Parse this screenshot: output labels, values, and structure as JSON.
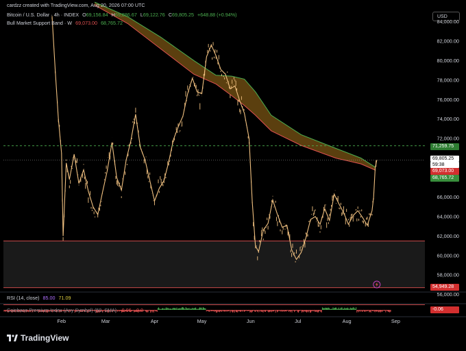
{
  "header": {
    "credit": "cardzz created with TradingView.com, Aug 20, 2026 07:00 UTC",
    "symbol": "Bitcoin / U.S. Dollar · 4h · INDEX",
    "open_label": "O",
    "open": "69,156.84",
    "high_label": "H",
    "high": "69,886.67",
    "low_label": "L",
    "low": "69,122.76",
    "close_label": "C",
    "close": "69,805.25",
    "change": "+648.88 (+0.94%)",
    "indicator": "Bull Market Support Band · W",
    "indicator_val1": "69,073.00",
    "indicator_val2": "68,765.72"
  },
  "currency_button": "USD",
  "price_tags": {
    "resistance": "71,259.75",
    "last": "69,805.25",
    "countdown": "59:38",
    "band_upper": "69,073.00",
    "band_lower": "68,765.72",
    "support": "54,949.28"
  },
  "rsi": {
    "label": "RSI (14, close)",
    "v1": "85.00",
    "v2": "71.09"
  },
  "premium": {
    "label": "Coinbase Premium Index (Any Symbol) (50, SMA)",
    "v1": "-0.06",
    "v2": "-0.0",
    "tag": "-0.06"
  },
  "brand": "TradingView",
  "colors": {
    "background": "#000000",
    "candle": "#f0c080",
    "band_fill": "#6b4a12",
    "band_upper": "#4caf50",
    "band_lower": "#e05050",
    "resistance_line": "#4caf50",
    "support_zone": "#e05050"
  },
  "chart_data": {
    "type": "line",
    "title": "",
    "xlabel": "",
    "ylabel": "",
    "x_ticks": [
      "Feb",
      "Mar",
      "Apr",
      "May",
      "Jun",
      "Jul",
      "Aug",
      "Sep"
    ],
    "y_ticks": [
      "84,000.00",
      "82,000.00",
      "80,000.00",
      "78,000.00",
      "76,000.00",
      "74,000.00",
      "72,000.00",
      "66,000.00",
      "64,000.00",
      "62,000.00",
      "60,000.00",
      "58,000.00",
      "56,000.00"
    ],
    "ylim": [
      55200,
      85600
    ],
    "grid": false,
    "series": [
      {
        "points": [
          [
            "Jan 26",
            84500
          ],
          [
            "Jan 28",
            79000
          ],
          [
            "Jan 30",
            74000
          ],
          [
            "Feb 1",
            70500
          ],
          [
            "Feb 2",
            62000
          ],
          [
            "Feb 4",
            69500
          ],
          [
            "Feb 6",
            67800
          ],
          [
            "Feb 9",
            70400
          ],
          [
            "Feb 12",
            67400
          ],
          [
            "Feb 15",
            68800
          ],
          [
            "Feb 18",
            66600
          ],
          [
            "Feb 21",
            65000
          ],
          [
            "Feb 24",
            64200
          ],
          [
            "Feb 27",
            66500
          ],
          [
            "Mar 2",
            68700
          ],
          [
            "Mar 5",
            71600
          ],
          [
            "Mar 8",
            68000
          ],
          [
            "Mar 11",
            66700
          ],
          [
            "Mar 14",
            69800
          ],
          [
            "Mar 17",
            71800
          ],
          [
            "Mar 20",
            74500
          ],
          [
            "Mar 23",
            71100
          ],
          [
            "Mar 26",
            69800
          ],
          [
            "Mar 29",
            67700
          ],
          [
            "Apr 1",
            65600
          ],
          [
            "Apr 4",
            66900
          ],
          [
            "Apr 7",
            67700
          ],
          [
            "Apr 10",
            69600
          ],
          [
            "Apr 13",
            71900
          ],
          [
            "Apr 16",
            73200
          ],
          [
            "Apr 19",
            74300
          ],
          [
            "Apr 22",
            76600
          ],
          [
            "Apr 25",
            78200
          ],
          [
            "Apr 28",
            76800
          ],
          [
            "May 1",
            76600
          ],
          [
            "May 4",
            80400
          ],
          [
            "May 7",
            81600
          ],
          [
            "May 10",
            80500
          ],
          [
            "May 13",
            79100
          ],
          [
            "May 16",
            78600
          ],
          [
            "May 19",
            77100
          ],
          [
            "May 22",
            77400
          ],
          [
            "May 25",
            75900
          ],
          [
            "May 28",
            74600
          ],
          [
            "May 31",
            72000
          ],
          [
            "Jun 2",
            65500
          ],
          [
            "Jun 4",
            61000
          ],
          [
            "Jun 6",
            60400
          ],
          [
            "Jun 9",
            62600
          ],
          [
            "Jun 12",
            63300
          ],
          [
            "Jun 15",
            65700
          ],
          [
            "Jun 18",
            64200
          ],
          [
            "Jun 21",
            62900
          ],
          [
            "Jun 24",
            63100
          ],
          [
            "Jun 27",
            60600
          ],
          [
            "Jun 30",
            59600
          ],
          [
            "Jul 3",
            60300
          ],
          [
            "Jul 6",
            61800
          ],
          [
            "Jul 9",
            63700
          ],
          [
            "Jul 12",
            64000
          ],
          [
            "Jul 15",
            63200
          ],
          [
            "Jul 18",
            64800
          ],
          [
            "Jul 21",
            63600
          ],
          [
            "Jul 24",
            66300
          ],
          [
            "Jul 27",
            65300
          ],
          [
            "Jul 30",
            64400
          ],
          [
            "Aug 2",
            63200
          ],
          [
            "Aug 5",
            64100
          ],
          [
            "Aug 8",
            64600
          ],
          [
            "Aug 11",
            63900
          ],
          [
            "Aug 14",
            63100
          ],
          [
            "Aug 17",
            64600
          ],
          [
            "Aug 18",
            66000
          ],
          [
            "Aug 19",
            69000
          ],
          [
            "Aug 20",
            69805.25
          ]
        ]
      }
    ],
    "band": [
      [
        "Feb 22",
        86000,
        85700
      ],
      [
        "Mar 15",
        84500,
        83800
      ],
      [
        "Apr 5",
        82400,
        81200
      ],
      [
        "Apr 26",
        80000,
        78600
      ],
      [
        "May 10",
        78500,
        77600
      ],
      [
        "May 20",
        78400,
        76400
      ],
      [
        "May 28",
        78100,
        75400
      ],
      [
        "Jun 4",
        76800,
        74400
      ],
      [
        "Jun 14",
        74400,
        72800
      ],
      [
        "Jul 3",
        72400,
        71300
      ],
      [
        "Jul 25",
        71000,
        70000
      ],
      [
        "Aug 10",
        70000,
        69400
      ],
      [
        "Aug 19",
        69073.0,
        68765.72
      ]
    ],
    "levels": {
      "resistance": 71259.75,
      "support_zone": [
        56700,
        61500
      ],
      "support": 54949.28
    }
  }
}
